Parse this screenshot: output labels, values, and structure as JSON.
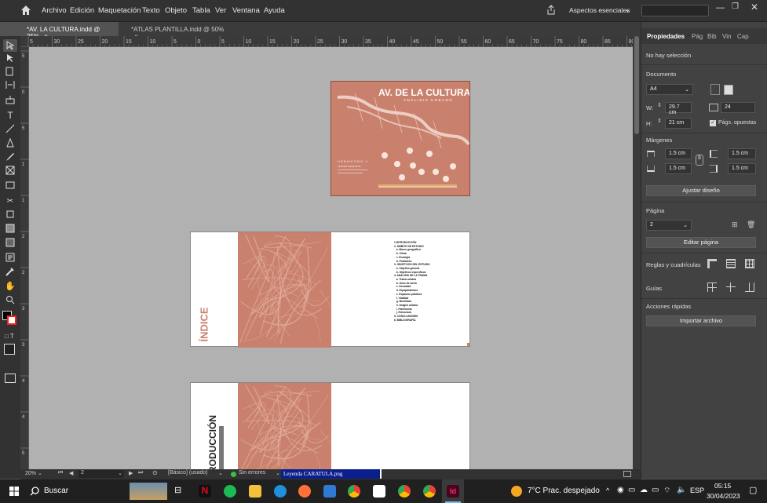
{
  "menu": [
    "Archivo",
    "Edición",
    "Maquetación",
    "Texto",
    "Objeto",
    "Tabla",
    "Ver",
    "Ventana",
    "Ayuda"
  ],
  "workspace": "Aspectos esenciales",
  "tabs": [
    {
      "label": "*AV. LA CULTURA.indd @ 25%"
    },
    {
      "label": "*ATLAS PLANTILLA.indd @ 50%"
    }
  ],
  "ruler_top_ticks": [
    "5",
    "30",
    "25",
    "20",
    "15",
    "10",
    "5",
    "0",
    "5",
    "10",
    "15",
    "20",
    "25",
    "30",
    "35",
    "40",
    "45",
    "50",
    "55",
    "60",
    "65",
    "70",
    "75",
    "80",
    "85",
    "90"
  ],
  "ruler_left_ticks": [
    "5",
    "0",
    "5",
    "1",
    "1",
    "2",
    "2",
    "3",
    "3",
    "4",
    "4",
    "5"
  ],
  "cover": {
    "title": "AV. DE LA CULTURA",
    "subtitle": "ANÁLISIS URBANO",
    "course": "URBANISMO II",
    "course_code": "TERCER SEMESTRE"
  },
  "index_page": {
    "title": "ÍNDICE"
  },
  "intro_page": {
    "title": "RODUCCIÓN"
  },
  "toc_lines": [
    "1.INTRODUCCIÓN",
    "2. ÁMBITO DE ESTUDIO",
    "   a. Marco geográfico",
    "   b. Clima",
    "   c. Ecología",
    "   d. Población",
    "3. OBJETIVOS DEL ESTUDIO",
    "   a. Objetivo general",
    "   b. Objetivos específicos",
    "4. ANÁLISIS DE LA TRAMA",
    "   a. Trama urbana",
    "   b. Usos de suelo",
    "   c. Densidad",
    "   d. Equipamientos",
    "   e. Espacios públicos",
    "   f. Vialidad",
    "   g. Movilidad",
    "   h. Imagen urbana",
    "   i. Patrimonio",
    "   j. Estructura",
    "5. CONCLUSIONES",
    "6. BIBLIOGRAFÍA"
  ],
  "panel": {
    "tabs": [
      "Propiedades",
      "Pág",
      "Bib",
      "Vin",
      "Cap"
    ],
    "no_selection": "No hay selección",
    "document_label": "Documento",
    "page_size": "A4",
    "w_label": "W:",
    "w_value": "29.7 cm",
    "h_label": "H:",
    "h_value": "21 cm",
    "pages_value": "24",
    "facing_pages": "Págs. opuestas",
    "margins_label": "Márgenes",
    "margin_top": "1.5 cm",
    "margin_bottom": "1.5 cm",
    "margin_left": "1.5 cm",
    "margin_right": "1.5 cm",
    "adjust_btn": "Ajustar diseño",
    "page_label": "Página",
    "page_value": "2",
    "edit_page_btn": "Editar página",
    "grids_label": "Reglas y cuadrículas",
    "guides_label": "Guías",
    "quick_actions": "Acciones rápidas",
    "import_btn": "Importar archivo"
  },
  "status": {
    "zoom": "20%",
    "page": "2",
    "preset": "[Básico] (usado)",
    "errors": "Sin errores",
    "tooltip": "Leyenda CARATULA.png"
  },
  "taskbar": {
    "search": "Buscar",
    "weather": "7°C  Prac. despejado",
    "lang": "ESP",
    "time": "05:15",
    "date": "30/04/2023"
  },
  "colors": {
    "terracotta": "#c9816d",
    "accent": "#31a8ff"
  }
}
